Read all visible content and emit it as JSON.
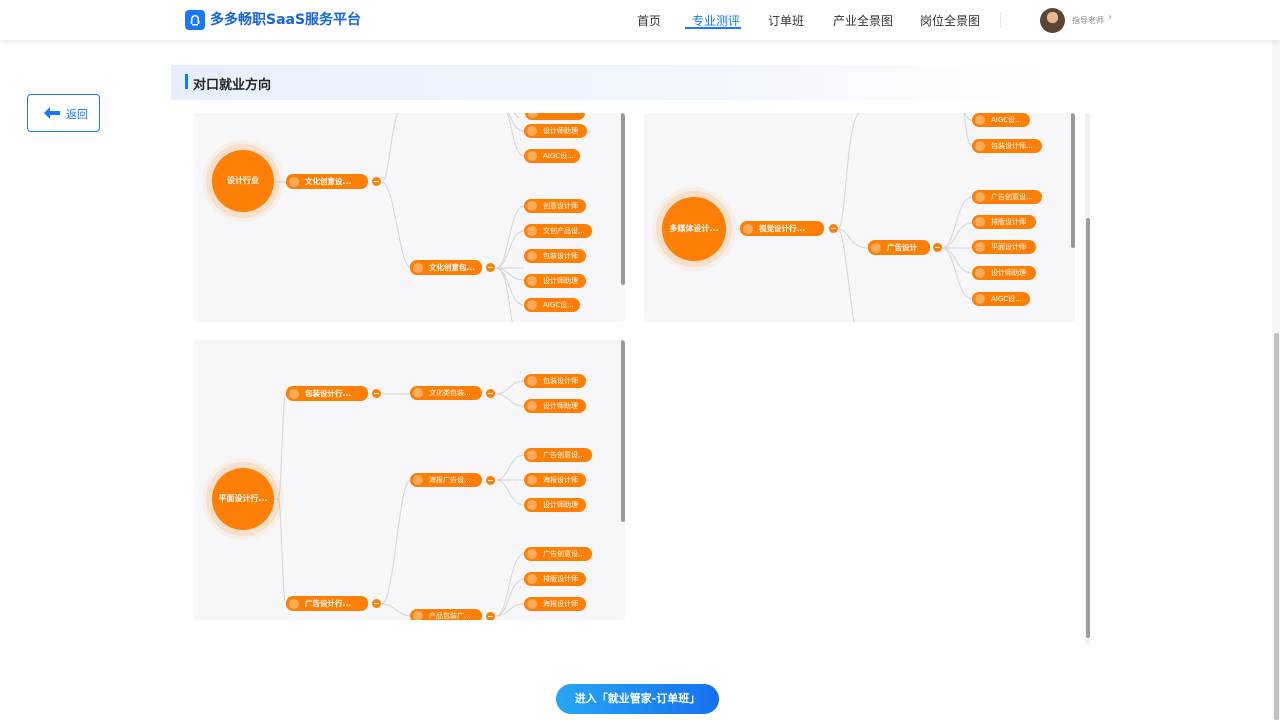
{
  "header": {
    "app_title": "多多畅职SaaS服务平台",
    "nav": [
      {
        "label": "首页"
      },
      {
        "label": "专业测评",
        "active": true
      },
      {
        "label": "订单班"
      },
      {
        "label": "产业全景图"
      },
      {
        "label": "岗位全景图"
      }
    ],
    "user_label": "指导老师",
    "user_chevron": "›"
  },
  "back_button": {
    "label": "返回"
  },
  "section": {
    "title": "对口就业方向"
  },
  "mindmaps": [
    {
      "root": "设计行业",
      "branch": "文化创意设...",
      "top_leaves": [
        "设计师助理",
        "AIGC设..."
      ],
      "sub_branch": "文化创意包...",
      "sub_leaves": [
        "创意设计师",
        "文创产品设...",
        "包装设计师",
        "设计师助理",
        "AIGC设..."
      ]
    },
    {
      "root": "多媒体设计...",
      "branch": "视觉设计行...",
      "top_leaves": [
        "AIGC设...",
        "包装设计师..."
      ],
      "sub_branch": "广告设计",
      "sub_leaves": [
        "广告创意设...",
        "排版设计师",
        "平面设计师",
        "设计师助理",
        "AIGC设..."
      ]
    },
    {
      "root": "平面设计行...",
      "branch_a": "包装设计行...",
      "branch_a_child": "文化类包装...",
      "branch_a_leaves": [
        "包装设计师",
        "设计师助理"
      ],
      "branch_mid": "海报广告设...",
      "branch_mid_leaves": [
        "广告创意设...",
        "海报设计师",
        "设计师助理"
      ],
      "branch_b": "广告设计行...",
      "branch_b_child": "产品包装广...",
      "branch_b_leaves": [
        "广告创意设...",
        "排版设计师",
        "海报设计师"
      ]
    }
  ],
  "cta": {
    "label": "进入「就业管家-订单班」"
  },
  "colors": {
    "primary": "#1677ff",
    "node": "#fe7f06",
    "panel_bg": "#f7f7f9"
  }
}
